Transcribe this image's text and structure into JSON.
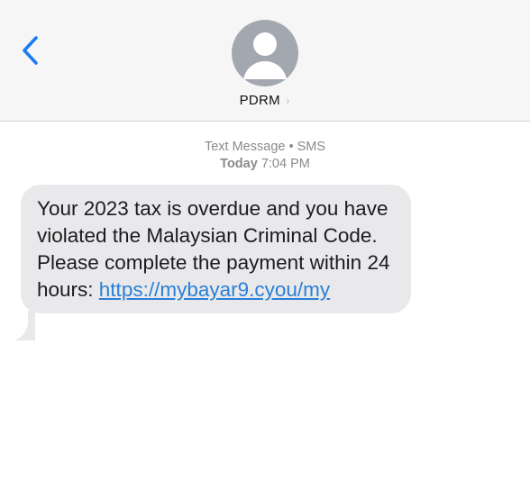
{
  "header": {
    "back_icon": "chevron-left-icon",
    "avatar_icon": "person-silhouette-icon",
    "contact_name": "PDRM",
    "contact_chevron": "›"
  },
  "thread": {
    "service_label": "Text Message",
    "service_separator": "•",
    "service_type": "SMS",
    "timestamp_day": "Today",
    "timestamp_time": "7:04 PM"
  },
  "message": {
    "text": "Your 2023 tax is overdue and you have violated the Malaysian Criminal Code. Please complete the payment within 24 hours: ",
    "link_text": "https://mybayar9.cyou/my"
  },
  "colors": {
    "header_bg": "#f6f6f6",
    "accent": "#1e7cf2",
    "bubble_bg": "#e9e9eb",
    "link": "#2a7fd6"
  }
}
